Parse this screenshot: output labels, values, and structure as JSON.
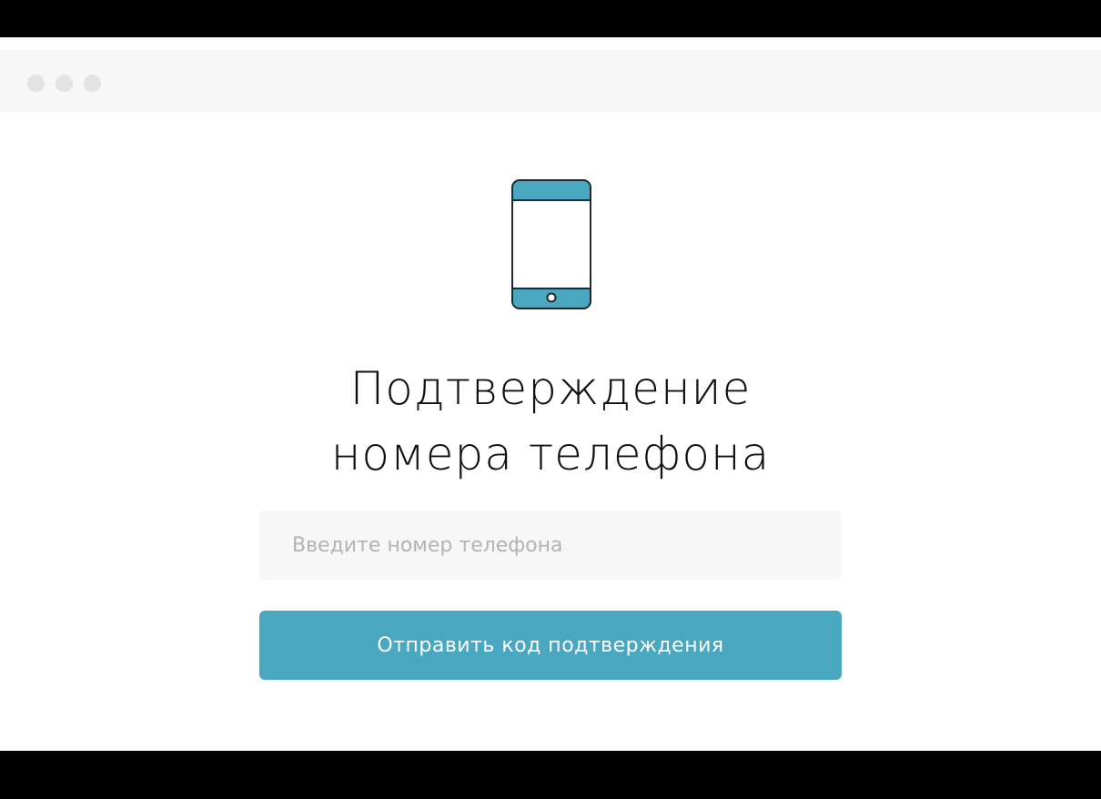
{
  "colors": {
    "accent": "#4aa7c0",
    "titlebar": "#f7f7f7",
    "window_dot": "#e3e3e3",
    "input_bg": "#f7f7f7"
  },
  "window": {
    "controls": [
      "close-dot",
      "minimize-dot",
      "maximize-dot"
    ]
  },
  "hero": {
    "icon": "smartphone-icon",
    "title_line1": "Подтверждение",
    "title_line2": "номера телефона"
  },
  "form": {
    "phone_placeholder": "Введите номер телефона",
    "phone_value": "",
    "submit_label": "Отправить код подтверждения"
  }
}
